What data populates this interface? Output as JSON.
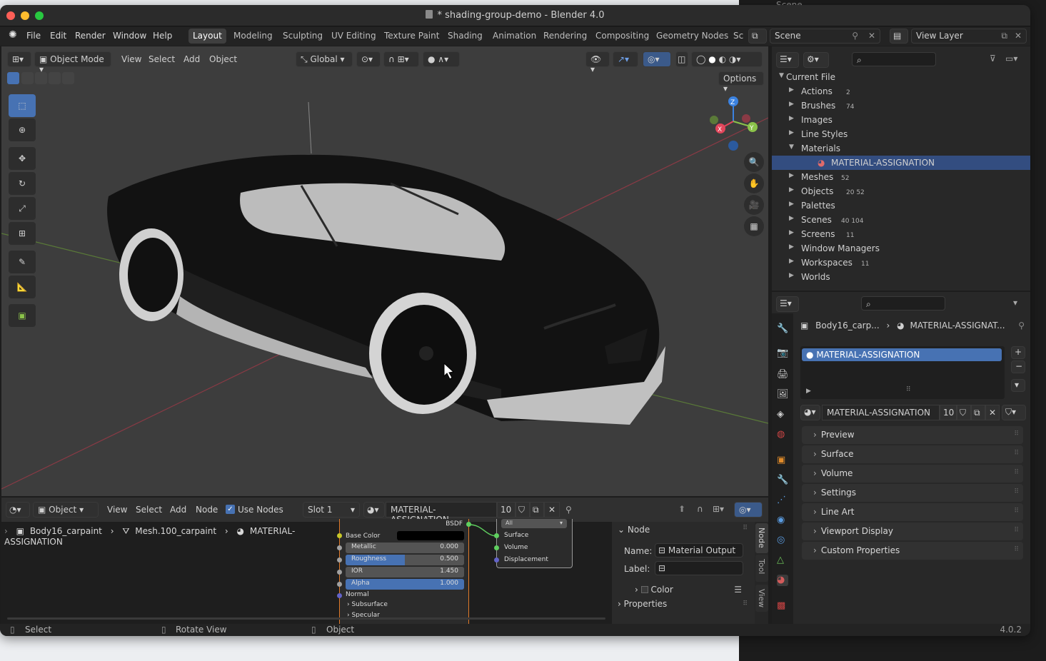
{
  "window": {
    "title": "* shading-group-demo - Blender 4.0",
    "behind_window_texts": [
      "Scene"
    ]
  },
  "menu": {
    "items": [
      "File",
      "Edit",
      "Render",
      "Window",
      "Help"
    ],
    "workspaces": [
      "Layout",
      "Modeling",
      "Sculpting",
      "UV Editing",
      "Texture Paint",
      "Shading",
      "Animation",
      "Rendering",
      "Compositing",
      "Geometry Nodes",
      "Sc"
    ],
    "active_workspace": "Layout",
    "scene": "Scene",
    "view_layer": "View Layer"
  },
  "viewport": {
    "mode": "Object Mode",
    "menus": [
      "View",
      "Select",
      "Add",
      "Object"
    ],
    "transform_orientation": "Global",
    "options_label": "Options",
    "gizmo_axes": [
      "X",
      "Y",
      "Z"
    ]
  },
  "outliner": {
    "root": "Current File",
    "items": [
      {
        "label": "Actions",
        "expanded": false,
        "count": "2"
      },
      {
        "label": "Brushes",
        "expanded": false,
        "count": "74"
      },
      {
        "label": "Images",
        "expanded": false,
        "count": ""
      },
      {
        "label": "Line Styles",
        "expanded": false,
        "count": ""
      },
      {
        "label": "Materials",
        "expanded": true,
        "count": ""
      },
      {
        "label": "MATERIAL-ASSIGNATION",
        "expanded": false,
        "count": "",
        "selected": true
      },
      {
        "label": "Meshes",
        "expanded": false,
        "count": "52"
      },
      {
        "label": "Objects",
        "expanded": false,
        "count": "20 52"
      },
      {
        "label": "Palettes",
        "expanded": false,
        "count": ""
      },
      {
        "label": "Scenes",
        "expanded": false,
        "count": "40 104"
      },
      {
        "label": "Screens",
        "expanded": false,
        "count": "11"
      },
      {
        "label": "Window Managers",
        "expanded": false,
        "count": ""
      },
      {
        "label": "Workspaces",
        "expanded": false,
        "count": "11"
      },
      {
        "label": "Worlds",
        "expanded": false,
        "count": ""
      }
    ]
  },
  "properties": {
    "breadcrumb_object": "Body16_carp...",
    "breadcrumb_material": "MATERIAL-ASSIGNAT...",
    "material_slot": "MATERIAL-ASSIGNATION",
    "material_name": "MATERIAL-ASSIGNATION",
    "user_count": "10",
    "panels": [
      "Preview",
      "Surface",
      "Volume",
      "Settings",
      "Line Art",
      "Viewport Display",
      "Custom Properties"
    ]
  },
  "node_editor": {
    "type": "Object",
    "menus": [
      "View",
      "Select",
      "Add",
      "Node"
    ],
    "use_nodes_label": "Use Nodes",
    "use_nodes": true,
    "slot": "Slot 1",
    "material": "MATERIAL-ASSIGNATION",
    "user_count": "10",
    "breadcrumb": [
      "Body16_carpaint",
      "Mesh.100_carpaint",
      "MATERIAL-ASSIGNATION"
    ],
    "bsdf_label": "BSDF",
    "bsdf_fields": [
      {
        "label": "Base Color",
        "value": ""
      },
      {
        "label": "Metallic",
        "value": "0.000"
      },
      {
        "label": "Roughness",
        "value": "0.500"
      },
      {
        "label": "IOR",
        "value": "1.450"
      },
      {
        "label": "Alpha",
        "value": "1.000"
      },
      {
        "label": "Normal",
        "value": ""
      },
      {
        "label": "Subsurface",
        "value": ""
      },
      {
        "label": "Specular",
        "value": ""
      }
    ],
    "output_target": "All",
    "output_sockets": [
      "Surface",
      "Volume",
      "Displacement"
    ],
    "sidebar": {
      "section": "Node",
      "name_label": "Name:",
      "name_value": "Material Output",
      "label_label": "Label:",
      "label_value": "",
      "color_label": "Color",
      "properties_label": "Properties",
      "tabs": [
        "Node",
        "Tool",
        "View"
      ]
    }
  },
  "statusbar": {
    "hints": [
      "Select",
      "Rotate View",
      "Object"
    ],
    "version": "4.0.2"
  },
  "colors": {
    "accent": "#4772b3",
    "selection": "#334d80",
    "axis_x": "#e2465b",
    "axis_y": "#8bc34a",
    "axis_z": "#3b82e0"
  }
}
